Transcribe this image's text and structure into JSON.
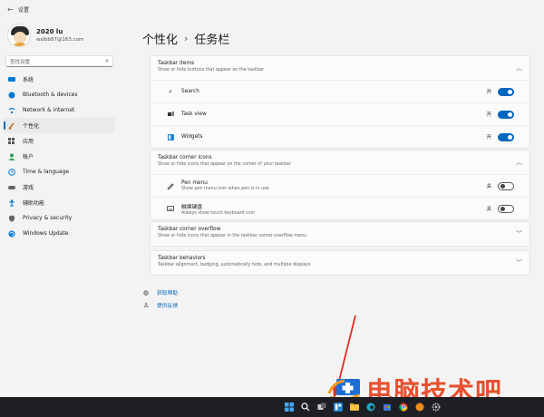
{
  "window": {
    "title": "设置"
  },
  "profile": {
    "name": "2020 lu",
    "email": "wslbb87@163.com"
  },
  "search": {
    "placeholder": "查找设置"
  },
  "sidebar": {
    "items": [
      {
        "label": "系统",
        "icon": "monitor-icon",
        "color": "#0078d4"
      },
      {
        "label": "Bluetooth & devices",
        "icon": "bluetooth-icon",
        "color": "#0078d4"
      },
      {
        "label": "Network & internet",
        "icon": "wifi-icon",
        "color": "#0078d4"
      },
      {
        "label": "个性化",
        "icon": "brush-icon",
        "color": "#c46a16"
      },
      {
        "label": "应用",
        "icon": "apps-icon",
        "color": "#555555"
      },
      {
        "label": "帐户",
        "icon": "person-icon",
        "color": "#2e9e55"
      },
      {
        "label": "Time & language",
        "icon": "globe-clock-icon",
        "color": "#0078d4"
      },
      {
        "label": "游戏",
        "icon": "gamepad-icon",
        "color": "#666666"
      },
      {
        "label": "辅助功能",
        "icon": "accessibility-icon",
        "color": "#0078d4"
      },
      {
        "label": "Privacy & security",
        "icon": "shield-icon",
        "color": "#666666"
      },
      {
        "label": "Windows Update",
        "icon": "update-icon",
        "color": "#0078d4"
      }
    ],
    "active_index": 3
  },
  "breadcrumb": {
    "parent": "个性化",
    "separator": "›",
    "current": "任务栏"
  },
  "sections": {
    "taskbar_items": {
      "title": "Taskbar items",
      "subtitle": "Show or hide buttons that appear on the taskbar",
      "rows": [
        {
          "label": "Search",
          "state": "开",
          "on": true,
          "icon": "search-icon"
        },
        {
          "label": "Task view",
          "state": "开",
          "on": true,
          "icon": "task-view-icon"
        },
        {
          "label": "Widgets",
          "state": "开",
          "on": true,
          "icon": "widgets-icon"
        }
      ]
    },
    "corner_icons": {
      "title": "Taskbar corner icons",
      "subtitle": "Show or hide icons that appear on the corner of your taskbar",
      "rows": [
        {
          "label": "Pen menu",
          "sublabel": "Show pen menu icon when pen is in use",
          "state": "关",
          "on": false,
          "icon": "pen-icon"
        },
        {
          "label": "触摸键盘",
          "sublabel": "Always show touch keyboard icon",
          "state": "关",
          "on": false,
          "icon": "keyboard-icon"
        }
      ]
    },
    "corner_overflow": {
      "title": "Taskbar corner overflow",
      "subtitle": "Show or hide icons that appear in the taskbar corner overflow menu"
    },
    "behaviors": {
      "title": "Taskbar behaviors",
      "subtitle": "Taskbar alignment, badging, automatically hide, and multiple displays"
    }
  },
  "links": {
    "help": "获取帮助",
    "feedback": "提供反馈"
  },
  "watermark": {
    "text": "电脑技术吧"
  },
  "colors": {
    "accent": "#0067c0",
    "annotation_arrow": "#e0302a",
    "watermark": "#e8502f"
  }
}
